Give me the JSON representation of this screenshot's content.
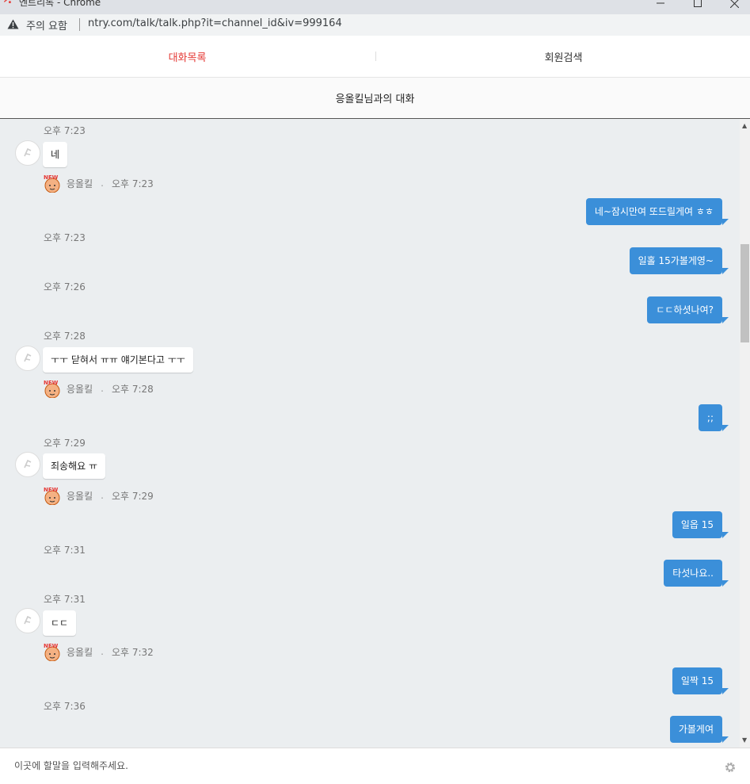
{
  "browser": {
    "window_title": "엔트리톡 - Chrome",
    "security_label": "주의 요함",
    "url": "ntry.com/talk/talk.php?it=channel_id&iv=999164"
  },
  "tabs": [
    {
      "label": "대화목록",
      "active": true
    },
    {
      "label": "회원검색",
      "active": false
    }
  ],
  "room_title": "응올킬님과의 대화",
  "contact_name": "응올킬",
  "colors": {
    "accent": "#e53935",
    "outgoing_bubble": "#3b8fd9",
    "chat_bg": "#ebeef0"
  },
  "messages": [
    {
      "type": "time",
      "text": "오후 7:23"
    },
    {
      "type": "in",
      "text": "네"
    },
    {
      "type": "meta",
      "name": "응올킬",
      "time": "오후 7:23"
    },
    {
      "type": "out",
      "text": "네~잠시만여 또드릴게여 ㅎㅎ"
    },
    {
      "type": "time",
      "text": "오후 7:23"
    },
    {
      "type": "out",
      "text": "일홀 15가볼게영~"
    },
    {
      "type": "time",
      "text": "오후 7:26"
    },
    {
      "type": "out",
      "text": "ㄷㄷ하셧나여?"
    },
    {
      "type": "time",
      "text": "오후 7:28"
    },
    {
      "type": "in",
      "text": "ㅜㅜ 닫혀서 ㅠㅠ 얘기본다고 ㅜㅜ"
    },
    {
      "type": "meta",
      "name": "응올킬",
      "time": "오후 7:28"
    },
    {
      "type": "out",
      "text": ";;"
    },
    {
      "type": "time",
      "text": "오후 7:29"
    },
    {
      "type": "in",
      "text": "죄송해요 ㅠ"
    },
    {
      "type": "meta",
      "name": "응올킬",
      "time": "오후 7:29"
    },
    {
      "type": "out",
      "text": "일옵 15"
    },
    {
      "type": "time",
      "text": "오후 7:31"
    },
    {
      "type": "out",
      "text": "타섯나요.."
    },
    {
      "type": "time",
      "text": "오후 7:31"
    },
    {
      "type": "in",
      "text": "ㄷㄷ"
    },
    {
      "type": "meta",
      "name": "응올킬",
      "time": "오후 7:32"
    },
    {
      "type": "out",
      "text": "일짝 15"
    },
    {
      "type": "time",
      "text": "오후 7:36"
    },
    {
      "type": "out",
      "text": "가볼게여"
    }
  ],
  "input": {
    "placeholder": "이곳에 할말을 입력해주세요.",
    "value": ""
  },
  "icons": {
    "warning": "warning-icon",
    "settings": "gear-icon",
    "avatar": "default-avatar-icon",
    "new_badge": "new-user-badge-icon"
  }
}
